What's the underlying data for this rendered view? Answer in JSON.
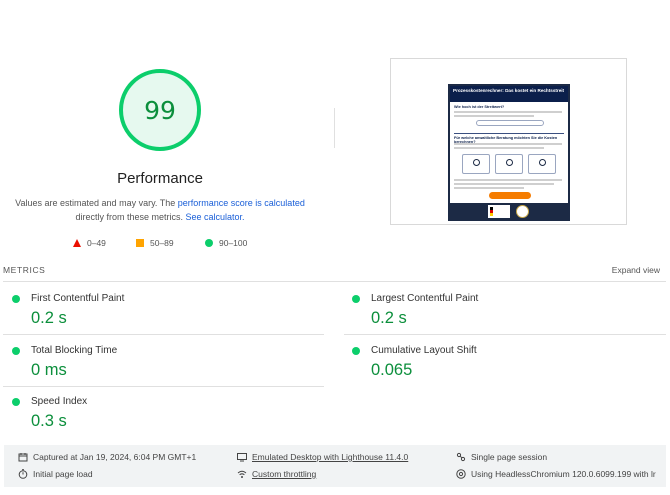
{
  "performance": {
    "score": "99",
    "title": "Performance",
    "desc_prefix": "Values are estimated and may vary. The ",
    "desc_link1": "performance score is calculated",
    "desc_middle": "directly from these metrics. ",
    "desc_link2": "See calculator.",
    "score_color": "#0cce6b"
  },
  "legend": [
    {
      "range": "0–49",
      "icon": "fail-triangle-icon",
      "color": "#eb0f00"
    },
    {
      "range": "50–89",
      "icon": "average-square-icon",
      "color": "#ffa400"
    },
    {
      "range": "90–100",
      "icon": "pass-circle-icon",
      "color": "#0cce6b"
    }
  ],
  "screenshot": {
    "page_title": "Prozesskostenrechner: Das kostet ein Rechtsstreit",
    "question1": "Wie hoch ist der Streitwert?",
    "question2": "Für welche anwaltliche Beratung möchten Sie die Kosten berechnen?"
  },
  "metrics": {
    "heading": "METRICS",
    "expand_label": "Expand view",
    "fcp": {
      "label": "First Contentful Paint",
      "value": "0.2 s"
    },
    "lcp": {
      "label": "Largest Contentful Paint",
      "value": "0.2 s"
    },
    "tbt": {
      "label": "Total Blocking Time",
      "value": "0 ms"
    },
    "cls": {
      "label": "Cumulative Layout Shift",
      "value": "0.065"
    },
    "si": {
      "label": "Speed Index",
      "value": "0.3 s"
    }
  },
  "footer": {
    "captured": "Captured at Jan 19, 2024, 6:04 PM GMT+1",
    "emulated": "Emulated Desktop with Lighthouse 11.4.0",
    "session": "Single page session",
    "load": "Initial page load",
    "throttling": "Custom throttling",
    "browser": "Using HeadlessChromium 120.0.6099.199 with lr"
  }
}
